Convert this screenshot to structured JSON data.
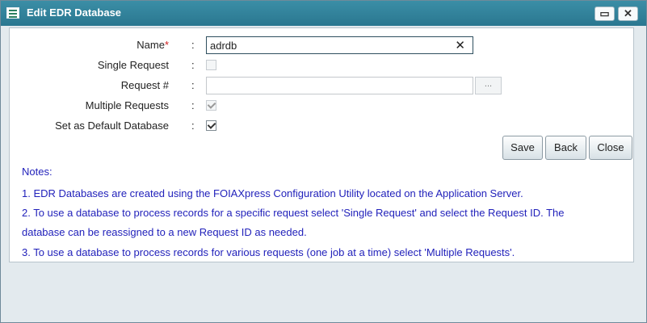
{
  "window": {
    "title": "Edit EDR Database",
    "max_icon": "maximize-icon",
    "close_icon": "close-icon"
  },
  "form": {
    "name": {
      "label": "Name",
      "required_marker": "*",
      "value": "adrdb",
      "clear_glyph": "✕"
    },
    "single_request": {
      "label": "Single Request",
      "checked": false,
      "enabled": false
    },
    "request_number": {
      "label": "Request #",
      "value": "",
      "browse_label": "..."
    },
    "multiple_requests": {
      "label": "Multiple Requests",
      "checked": true,
      "enabled": false
    },
    "default_db": {
      "label": "Set as Default Database",
      "checked": true,
      "enabled": true
    },
    "colon": ":"
  },
  "buttons": {
    "save": "Save",
    "back": "Back",
    "close": "Close"
  },
  "notes": {
    "heading": "Notes:",
    "lines": [
      "1. EDR Databases are created using the FOIAXpress Configuration Utility located on the Application Server.",
      "2. To use a database to process records for a specific request select 'Single Request' and select the Request ID. The",
      "database can be reassigned to a new Request ID as needed.",
      "3. To use a database to process records for various requests (one job at a time) select 'Multiple Requests'."
    ]
  },
  "colors": {
    "titlebar": "#2f82a0",
    "notes_text": "#2222bb",
    "required": "#d02020"
  }
}
